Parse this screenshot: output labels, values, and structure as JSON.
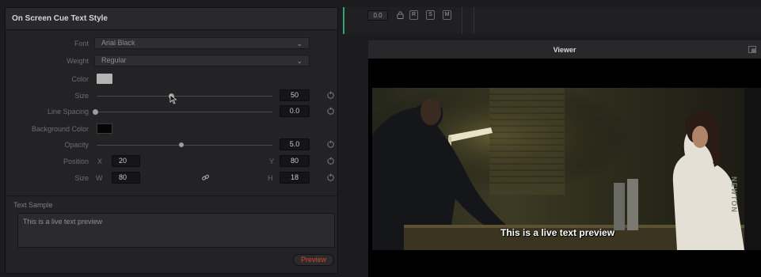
{
  "panel": {
    "title": "On Screen Cue Text Style",
    "font": {
      "label": "Font",
      "value": "Arial Black"
    },
    "weight": {
      "label": "Weight",
      "value": "Regular"
    },
    "color": {
      "label": "Color",
      "swatch": "#b4b4b4"
    },
    "size": {
      "label": "Size",
      "value": "50"
    },
    "line_spacing": {
      "label": "Line Spacing",
      "value": "0.0"
    },
    "background_color": {
      "label": "Background Color",
      "swatch": "#050505"
    },
    "opacity": {
      "label": "Opacity",
      "value": "5.0"
    },
    "position": {
      "label": "Position",
      "x_label": "X",
      "x": "20",
      "y_label": "Y",
      "y": "80"
    },
    "box_size": {
      "label": "Size",
      "w_label": "W",
      "w": "80",
      "h_label": "H",
      "h": "18"
    },
    "sample": {
      "header": "Text Sample",
      "text": "This is a live text preview"
    },
    "preview_button": "Preview"
  },
  "track_header": {
    "timecode": "0.0",
    "buttons": [
      "R",
      "S",
      "M"
    ]
  },
  "viewer": {
    "title": "Viewer",
    "caption": "This is a live text preview",
    "sign_text": "NEWTON"
  },
  "colors": {
    "accent_green": "#2fa573",
    "preview_red": "#d8482a"
  }
}
